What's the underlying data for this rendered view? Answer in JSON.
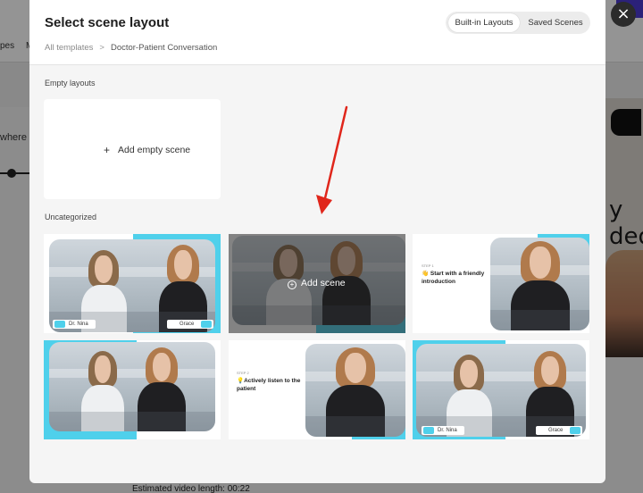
{
  "modal": {
    "title": "Select scene layout",
    "tabs": [
      {
        "label": "Built-in Layouts",
        "active": true
      },
      {
        "label": "Saved Scenes",
        "active": false
      }
    ],
    "breadcrumb": {
      "root": "All templates",
      "separator": ">",
      "current": "Doctor-Patient Conversation"
    },
    "close_icon": "×"
  },
  "sections": {
    "empty": {
      "label": "Empty layouts",
      "card_label": "Add empty scene",
      "plus": "+"
    },
    "uncategorized": {
      "label": "Uncategorized"
    }
  },
  "scenes": {
    "card1": {
      "tag_left": "Dr. Nina",
      "tag_right": "Grace"
    },
    "card2": {
      "hover_label": "Add scene",
      "hover_icon": "+"
    },
    "card3": {
      "step_label": "STEP 1",
      "text": "👋 Start with a friendly introduction"
    },
    "card5": {
      "step_label": "STEP 2",
      "text": "💡Actively listen to the patient"
    },
    "card6": {
      "tag_left": "Dr. Nina",
      "tag_right": "Grace"
    }
  },
  "background": {
    "estimated_length": "Estimated video length: 00:22",
    "left_word": "where",
    "right_text": "y\ndeo"
  },
  "colors": {
    "accent": "#4fd0eb",
    "annotation_arrow": "#e0261b"
  }
}
